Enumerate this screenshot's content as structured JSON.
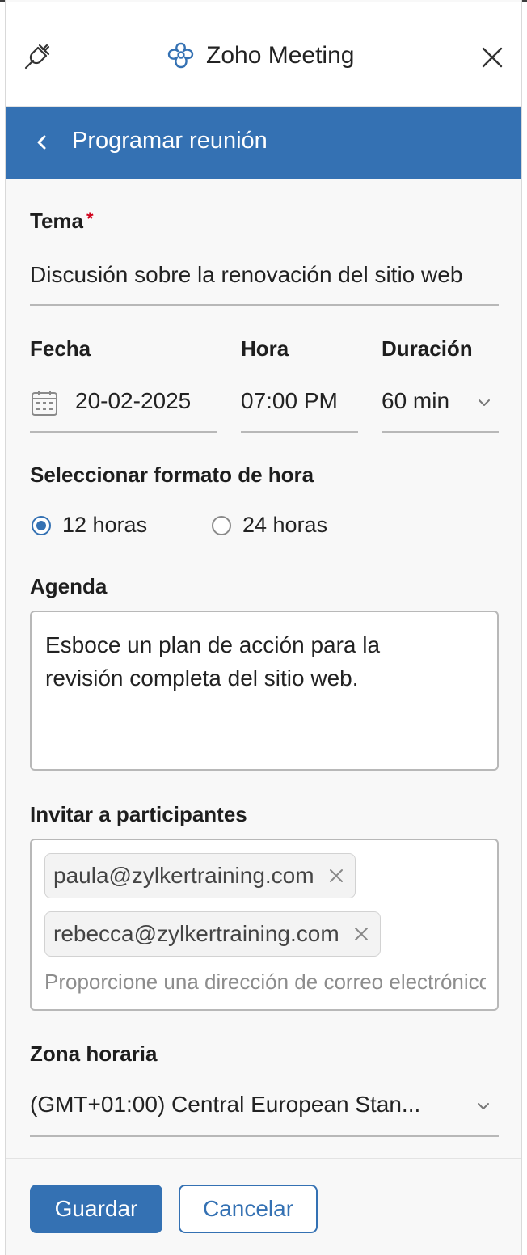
{
  "window": {
    "app_title": "Zoho Meeting",
    "icons": {
      "left": "plug-icon",
      "brand": "zoho-meeting-logo-icon",
      "close": "close-icon"
    }
  },
  "header": {
    "title": "Programar reunión",
    "back_icon": "chevron-left-icon"
  },
  "form": {
    "topic": {
      "label": "Tema",
      "required_mark": "*",
      "value": "Discusión sobre la renovación del sitio web"
    },
    "date": {
      "label": "Fecha",
      "value": "20-02-2025",
      "icon": "calendar-icon"
    },
    "time": {
      "label": "Hora",
      "value": "07:00 PM"
    },
    "duration": {
      "label": "Duración",
      "value": "60 min",
      "icon": "chevron-down-icon"
    },
    "time_format": {
      "label": "Seleccionar formato de hora",
      "options": [
        {
          "label": "12 horas",
          "selected": true
        },
        {
          "label": "24 horas",
          "selected": false
        }
      ]
    },
    "agenda": {
      "label": "Agenda",
      "value": "Esboce un plan de acción para la revisión completa del sitio web."
    },
    "participants": {
      "label": "Invitar a participantes",
      "chips": [
        "paula@zylkertraining.com",
        "rebecca@zylkertraining.com"
      ],
      "placeholder": "Proporcione una dirección de correo electrónico"
    },
    "timezone": {
      "label": "Zona horaria",
      "value": "(GMT+01:00) Central European Stan..."
    }
  },
  "footer": {
    "save_label": "Guardar",
    "cancel_label": "Cancelar"
  },
  "colors": {
    "accent": "#3471b3",
    "required": "#d0021b",
    "panel_bg": "#f8f8f8"
  }
}
